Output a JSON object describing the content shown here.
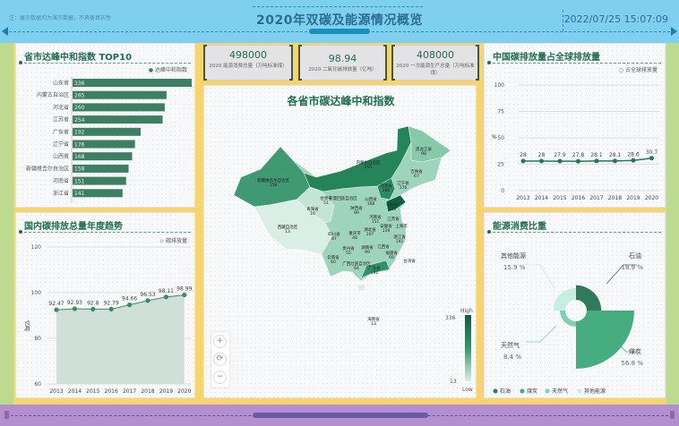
{
  "header": {
    "note": "注：展示数据均为演示数据，不具备真实性",
    "title": "2020年双碳及能源情况概览",
    "datetime": "2022/07/25 15:07:09"
  },
  "kpis": [
    {
      "value": "498000",
      "label": "2020 能源消费总量（万吨标准煤）"
    },
    {
      "value": "98.94",
      "label": "2020 二氧化碳排放量（亿吨）"
    },
    {
      "value": "408000",
      "label": "2020 一次能源生产总量（万吨标准煤）"
    }
  ],
  "map": {
    "title": "各省市碳达峰中和指数",
    "visual_map": {
      "max": "336",
      "min": "13",
      "high_label": "High",
      "low_label": "Low"
    },
    "zoom_controls": [
      "+",
      "⟳",
      "−"
    ],
    "regions": [
      {
        "name": "黑龙江省",
        "value": "98"
      },
      {
        "name": "吉林省",
        "value": "67"
      },
      {
        "name": "辽宁省",
        "value": "176"
      },
      {
        "name": "内蒙古自治区",
        "value": "265"
      },
      {
        "name": "新疆维吾尔自治区",
        "value": "158"
      },
      {
        "name": "甘肃省",
        "value": "51"
      },
      {
        "name": "宁夏回族自治区",
        "value": ""
      },
      {
        "name": "山西省",
        "value": "168"
      },
      {
        "name": "河北省",
        "value": "260"
      },
      {
        "name": "陕西省",
        "value": "89"
      },
      {
        "name": "青海省",
        "value": "16"
      },
      {
        "name": "西藏自治区",
        "value": "13"
      },
      {
        "name": "山东省",
        "value": "336"
      },
      {
        "name": "河南省",
        "value": "151"
      },
      {
        "name": "江苏省",
        "value": ""
      },
      {
        "name": "安徽省",
        "value": "119"
      },
      {
        "name": "上海市",
        "value": ""
      },
      {
        "name": "四川省",
        "value": "87"
      },
      {
        "name": "重庆市",
        "value": "48"
      },
      {
        "name": "湖北省",
        "value": "107"
      },
      {
        "name": "浙江省",
        "value": "141"
      },
      {
        "name": "贵州省",
        "value": "55"
      },
      {
        "name": "湖南省",
        "value": "99"
      },
      {
        "name": "江西省",
        "value": ""
      },
      {
        "name": "福建省",
        "value": "69"
      },
      {
        "name": "云南省",
        "value": "60"
      },
      {
        "name": "广西壮族自治区",
        "value": "64"
      },
      {
        "name": "广东省",
        "value": "192"
      },
      {
        "name": "台湾省",
        "value": ""
      },
      {
        "name": "海南省",
        "value": "13"
      }
    ]
  },
  "chart_data": [
    {
      "type": "bar",
      "title": "省市达峰中和指数 TOP10",
      "legend": "达峰中和指数",
      "orientation": "horizontal",
      "categories": [
        "山东省",
        "内蒙古自治区",
        "河北省",
        "江苏省",
        "广东省",
        "辽宁省",
        "山西省",
        "新疆维吾尔自治区",
        "河南省",
        "浙江省"
      ],
      "values": [
        336,
        265,
        260,
        254,
        192,
        176,
        168,
        158,
        151,
        141
      ],
      "color": "#3d7f63"
    },
    {
      "type": "area",
      "title": "国内碳排放总量年度趋势",
      "legend": "碳排放量",
      "ylabel": "亿吨",
      "x": [
        "2013",
        "2014",
        "2015",
        "2016",
        "2017",
        "2018",
        "2019",
        "2020"
      ],
      "values": [
        92.47,
        92.93,
        92.8,
        92.79,
        94.66,
        96.53,
        98.11,
        98.99
      ],
      "ylim": [
        60,
        120
      ],
      "yticks": [
        "60",
        "80",
        "100",
        "120"
      ],
      "color": "#3d8a68"
    },
    {
      "type": "line",
      "title": "中国碳排放量占全球排放量",
      "legend": "占全球排放量",
      "ylabel": "%",
      "x": [
        "2013",
        "2014",
        "2015",
        "2016",
        "2017",
        "2018",
        "2019",
        "2020"
      ],
      "values": [
        28,
        28,
        27.9,
        27.8,
        28.1,
        28.1,
        28.6,
        30.7
      ],
      "ylim": [
        0,
        100
      ],
      "yticks": [
        "0",
        "25",
        "50",
        "75",
        "100"
      ],
      "color": "#1f7a55"
    },
    {
      "type": "pie",
      "title": "能源消费比重",
      "rose": true,
      "slices": [
        {
          "name": "石油",
          "value": 18.9,
          "label": "18.9 %",
          "color": "#2f7a5c"
        },
        {
          "name": "煤炭",
          "value": 56.8,
          "label": "56.8 %",
          "color": "#45ad80"
        },
        {
          "name": "天然气",
          "value": 8.4,
          "label": "8.4 %",
          "color": "#7fcfb0"
        },
        {
          "name": "其他能源",
          "value": 15.9,
          "label": "15.9 %",
          "color": "#c6eee2"
        }
      ]
    }
  ]
}
